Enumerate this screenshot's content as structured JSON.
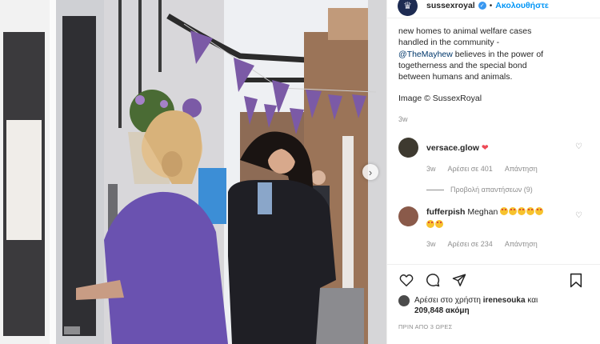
{
  "header": {
    "username": "sussexroyal",
    "follow_label": "Ακολουθήστε",
    "separator": "•"
  },
  "caption": {
    "line1": "new homes to animal welfare cases",
    "line2": "handled in the community -",
    "mention": "@TheMayhew",
    "line3_rest": " believes in the power of",
    "line4": "togetherness and the special bond",
    "line5": "between humans and animals.",
    "credit": "Image © SussexRoyal",
    "age": "3w"
  },
  "comments": [
    {
      "username": "versace.glow",
      "text": "",
      "emoji": "❤",
      "age": "3w",
      "likes": "Αρέσει σε 401",
      "reply_label": "Απάντηση",
      "view_replies": "Προβολή απαντήσεων (9)"
    },
    {
      "username": "fufferpish",
      "text": "Meghan",
      "age": "3w",
      "likes": "Αρέσει σε 234",
      "reply_label": "Απάντηση"
    }
  ],
  "likes": {
    "prefix": "Αρέσει στο χρήστη ",
    "user": "irenesouka",
    "suffix": " και",
    "others": "209,848 ακόμη"
  },
  "timestamp": "ΠΡΙΝ ΑΠΟ 3 ΩΡΕΣ",
  "icons": {
    "header_verified": "verified-badge-icon",
    "like": "heart-outline-icon",
    "comment": "comment-bubble-icon",
    "share": "paper-plane-icon",
    "save": "bookmark-icon",
    "next": "chevron-right-icon"
  },
  "colors": {
    "link_blue": "#0095f6",
    "mention_blue": "#00376b",
    "muted_gray": "#8e8e8e",
    "bunting_purple": "#7b5aa6",
    "shirt_purple": "#6a52b0"
  }
}
